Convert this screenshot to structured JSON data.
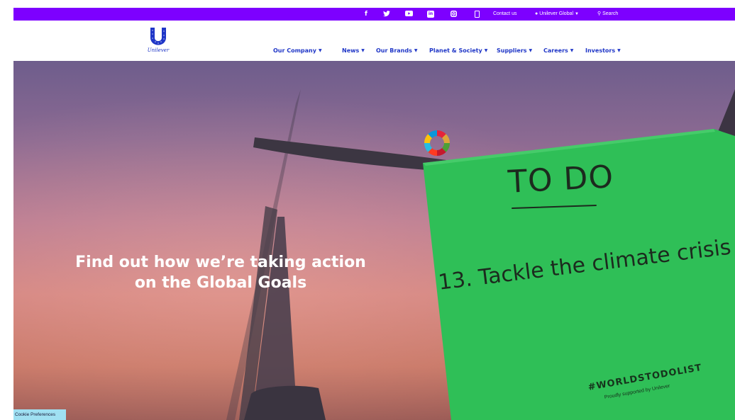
{
  "topbar": {
    "social": [
      "facebook-icon",
      "twitter-icon",
      "youtube-icon",
      "linkedin-icon",
      "instagram-icon",
      "mobile-icon"
    ],
    "contact": "Contact us",
    "region": "Unilever Global",
    "search": "Search",
    "background": "#7d00ff"
  },
  "header": {
    "logo_text": "Unilever",
    "nav": [
      {
        "label": "Our Company"
      },
      {
        "label": "News"
      },
      {
        "label": "Our Brands"
      },
      {
        "label": "Planet & Society"
      },
      {
        "label": "Suppliers"
      },
      {
        "label": "Careers"
      },
      {
        "label": "Investors"
      }
    ],
    "brand_color": "#1f36c7"
  },
  "hero": {
    "heading_line1": "Find out how we’re taking action",
    "heading_line2": "on the Global Goals",
    "note": {
      "title": "TO DO",
      "goal": "13. Tackle the climate crisis",
      "hashtag": "#WORLDSTODOLIST",
      "tagline": "Proudly supported by Unilever",
      "color": "#2fbf57"
    }
  },
  "cookie": {
    "label": "Cookie Preferences"
  }
}
